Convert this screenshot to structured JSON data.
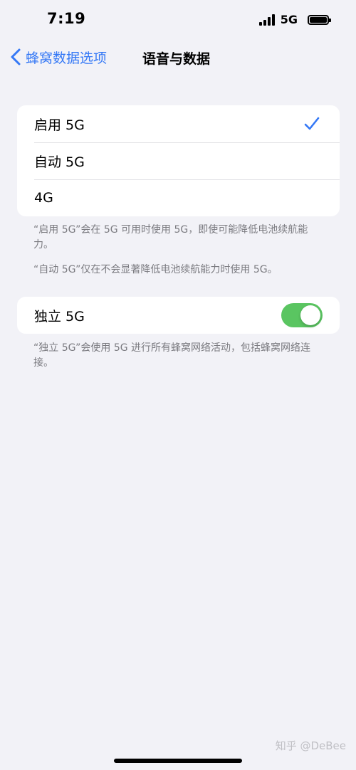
{
  "status_bar": {
    "time": "7:19",
    "network": "5G",
    "signal_icon": "cellular-signal-icon",
    "battery_icon": "battery-icon"
  },
  "nav": {
    "back_label": "蜂窝数据选项",
    "back_icon": "chevron-left-icon",
    "title": "语音与数据"
  },
  "options_group": {
    "items": [
      {
        "label": "启用 5G",
        "selected": true
      },
      {
        "label": "自动 5G",
        "selected": false
      },
      {
        "label": "4G",
        "selected": false
      }
    ],
    "check_icon": "checkmark-icon",
    "note_1": "“启用 5G”会在 5G 可用时使用 5G，即使可能降低电池续航能力。",
    "note_2": "“自动 5G”仅在不会显著降低电池续航能力时使用 5G。"
  },
  "standalone_group": {
    "label": "独立 5G",
    "toggle_on": true,
    "note": "“独立 5G”会使用 5G 进行所有蜂窝网络活动，包括蜂窝网络连接。"
  },
  "watermark": "知乎 @DeBee",
  "colors": {
    "accent": "#3478f6",
    "toggle_on": "#5ac561",
    "background": "#f2f2f7",
    "note_text": "#7b7b80"
  }
}
